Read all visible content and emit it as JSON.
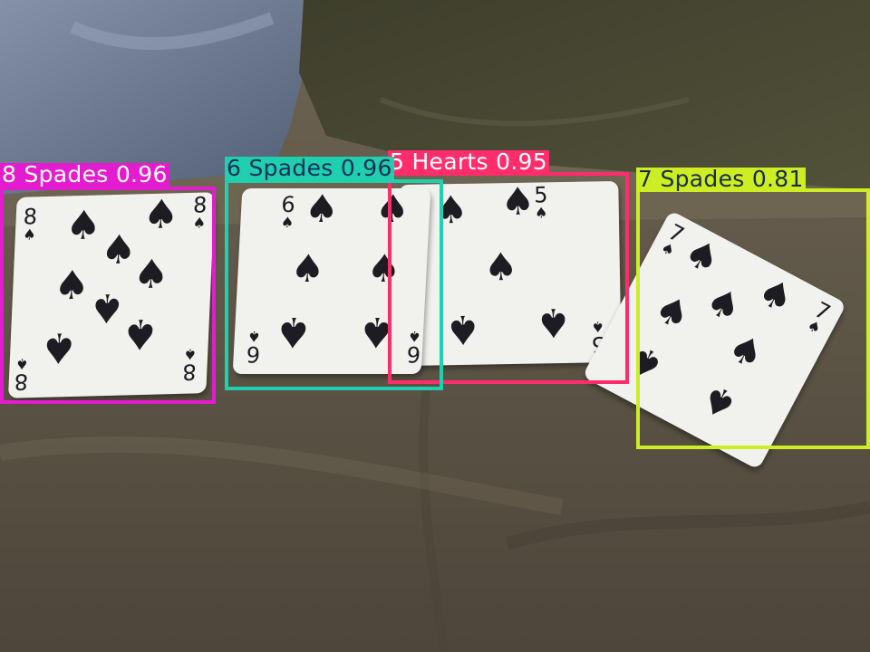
{
  "detections": [
    {
      "label": "8 Spades 0.96",
      "color": "#e31ccf",
      "text_color": "#ffffff"
    },
    {
      "label": "6 Spades 0.96",
      "color": "#1fcfae",
      "text_color": "#17305a"
    },
    {
      "label": "5 Hearts 0.95",
      "color": "#ff2d6b",
      "text_color": "#ffffff"
    },
    {
      "label": "7 Spades 0.81",
      "color": "#ccee22",
      "text_color": "#1a2d4a"
    }
  ],
  "cards": [
    {
      "rank": "8",
      "suit_symbol": "♠"
    },
    {
      "rank": "6",
      "suit_symbol": "♠"
    },
    {
      "rank": "5",
      "suit_symbol": "♠"
    },
    {
      "rank": "7",
      "suit_symbol": "♠"
    }
  ]
}
